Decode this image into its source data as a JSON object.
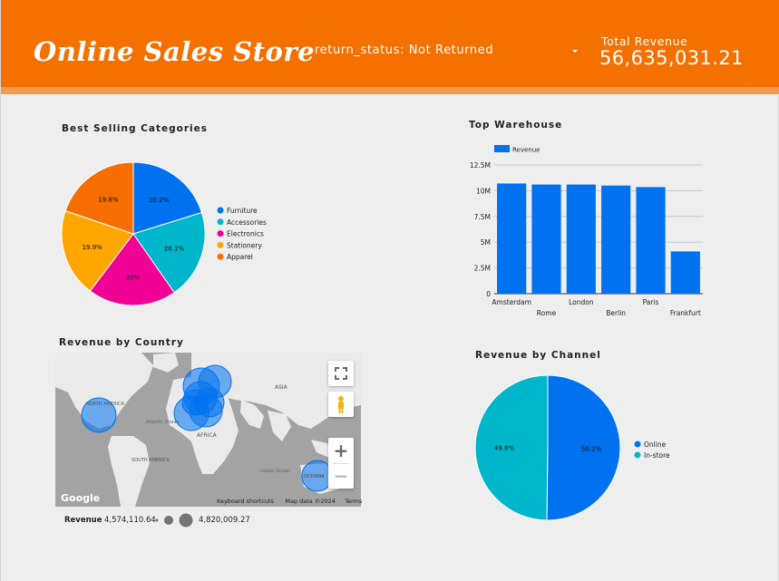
{
  "header": {
    "title": "Online Sales Store",
    "filter_label": "return_status: Not Returned",
    "kpi_label": "Total Revenue",
    "kpi_value": "56,635,031.21",
    "brand_color": "#f47100"
  },
  "chart_data": [
    {
      "type": "pie",
      "title": "Best Selling Categories",
      "labels": [
        "Furniture",
        "Accessories",
        "Electronics",
        "Stationery",
        "Apparel"
      ],
      "values": [
        20.2,
        20.1,
        20.0,
        19.9,
        19.8
      ],
      "display_labels": [
        "20.2%",
        "20.1%",
        "20%",
        "19.9%",
        "19.8%"
      ],
      "colors": [
        "#0072f0",
        "#00b6cb",
        "#f10096",
        "#ffa600",
        "#f66d00"
      ],
      "legend_position": "right"
    },
    {
      "type": "bar",
      "title": "Top Warehouse",
      "categories": [
        "Amsterdam",
        "Rome",
        "London",
        "Berlin",
        "Paris",
        "Frankfurt"
      ],
      "series": [
        {
          "name": "Revenue",
          "values": [
            10700000,
            10600000,
            10600000,
            10500000,
            10350000,
            4100000
          ],
          "color": "#0072f0"
        }
      ],
      "y_ticks": [
        "0",
        "2.5M",
        "5M",
        "7.5M",
        "10M",
        "12.5M"
      ],
      "ylim": [
        0,
        12500000
      ],
      "grid": true,
      "legend_position": "top-left"
    },
    {
      "type": "pie",
      "title": "Revenue by Channel",
      "labels": [
        "Online",
        "In-store"
      ],
      "values": [
        50.2,
        49.8
      ],
      "display_labels": [
        "50.2%",
        "49.8%"
      ],
      "colors": [
        "#0072f0",
        "#00b6cb"
      ],
      "legend_position": "right"
    }
  ],
  "map": {
    "title": "Revenue by Country",
    "labels": {
      "asia": "ASIA",
      "north_america": "NORTH AMERICA",
      "atlantic": "Atlantic Ocean",
      "africa": "AFRICA",
      "south_america": "SOUTH AMERICA",
      "indian": "Indian Ocean",
      "oceania": "OCEANIA"
    },
    "google_label": "Google",
    "footer": [
      "Keyboard shortcuts",
      "Map data ©2024",
      "Terms"
    ],
    "controls": {
      "zoom_in": "+",
      "zoom_out": "−"
    },
    "bubble_color": "#0072f0",
    "legend": {
      "label": "Revenue",
      "min": "4,574,110.64",
      "max": "4,820,009.27"
    }
  }
}
